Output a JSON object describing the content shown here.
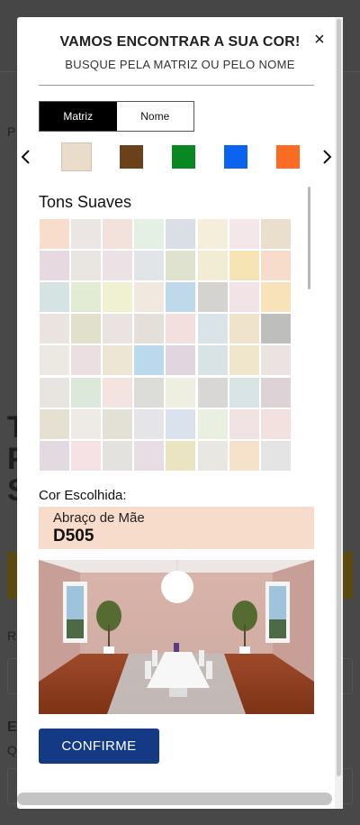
{
  "background": {
    "fragments": [
      "Ti",
      "P",
      "S",
      "R",
      "Es",
      "Q",
      "P"
    ]
  },
  "modal": {
    "title": "VAMOS ENCONTRAR A SUA COR!",
    "subtitle": "BUSQUE PELA MATRIZ OU PELO NOME",
    "close_icon": "×",
    "tabs": [
      {
        "label": "Matriz",
        "active": true
      },
      {
        "label": "Nome",
        "active": false
      }
    ],
    "matrix_colors": [
      "#e9dccb",
      "#6b4119",
      "#098723",
      "#0c63f0",
      "#fb6b24"
    ],
    "selected_matrix_index": 0,
    "section_title": "Tons Suaves",
    "color_grid": [
      [
        "#f9ddcc",
        "#ebe5e3",
        "#f3e2dc",
        "#e3f0e3",
        "#d9dfe4",
        "#f4eedb",
        "#f3e7e9",
        "#e9dfcc"
      ],
      [
        "#e6d9df",
        "#e9e6e1",
        "#ece1e4",
        "#e2e5e7",
        "#dfe2cf",
        "#f3ecd4",
        "#f7e4b5",
        "#f8dccb"
      ],
      [
        "#d6e3e3",
        "#e2ecd4",
        "#eff1d0",
        "#f1e8df",
        "#bfd8ea",
        "#d5d3d0",
        "#f2e4e6",
        "#f7e2ba"
      ],
      [
        "#ebe3e0",
        "#e1e0cb",
        "#ebe3e2",
        "#e4e0d9",
        "#f1e0dd",
        "#d9e3e8",
        "#efe3cc",
        "#bebebc"
      ],
      [
        "#ece9e4",
        "#ecdfe1",
        "#eee6d5",
        "#bad9ec",
        "#e1d6e0",
        "#d7e3e5",
        "#efe6cc",
        "#ebe3e1"
      ],
      [
        "#e8e5e1",
        "#dce8da",
        "#f3e4df",
        "#dcdcd8",
        "#efefe1",
        "#d9d6d6",
        "#d9e4e6",
        "#ddd2d6"
      ],
      [
        "#e6e0d2",
        "#eeeae6",
        "#e3e0d6",
        "#e5e5e9",
        "#dae3ed",
        "#e9efe1",
        "#f1e2e3",
        "#f2e1de"
      ],
      [
        "#e3d9e0",
        "#f6e1e5",
        "#e4e2de",
        "#e9dde4",
        "#ebe4c2",
        "#e8e7e2",
        "#f6e2ca",
        "#e5e4e4"
      ]
    ],
    "chosen_label": "Cor Escolhida:",
    "chosen_color": {
      "name": "Abraço de Mãe",
      "code": "D505",
      "hex": "#f8dccb"
    },
    "confirm_label": "CONFIRME"
  }
}
